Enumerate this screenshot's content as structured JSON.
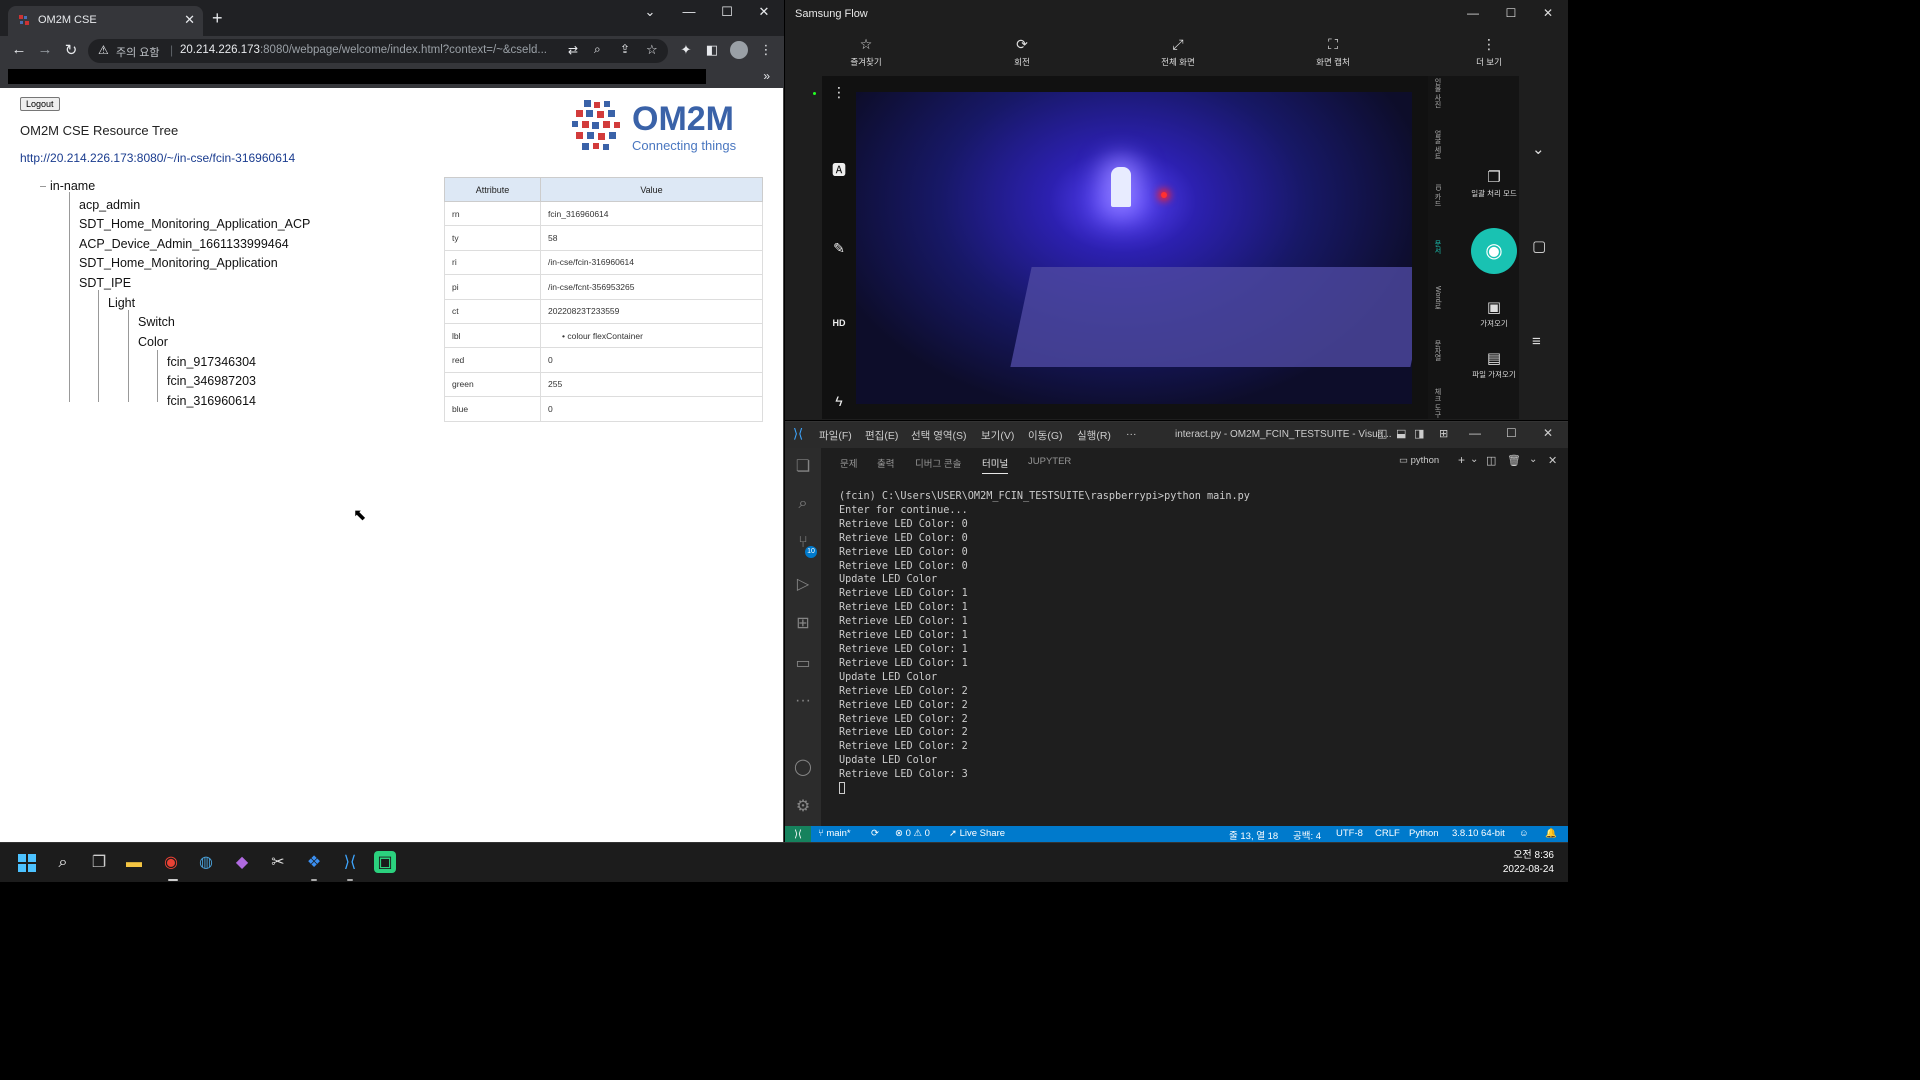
{
  "chrome": {
    "tab_title": "OM2M CSE",
    "new_tab": "+",
    "security_label": "주의 요함",
    "url_host": "20.214.226.173",
    "url_path": ":8080/webpage/welcome/index.html?context=/~&cseld...",
    "more_bookmarks": "»"
  },
  "om2m": {
    "logout_label": "Logout",
    "title": "OM2M CSE Resource Tree",
    "resource_url": "http://20.214.226.173:8080/~/in-cse/fcin-316960614",
    "logo_text": "OM2M",
    "logo_subtext": "Connecting things",
    "tree": {
      "root": "in-name",
      "n1": "acp_admin",
      "n2": "SDT_Home_Monitoring_Application_ACP",
      "n3": "ACP_Device_Admin_1661133999464",
      "n4": "SDT_Home_Monitoring_Application",
      "n5": "SDT_IPE",
      "n6": "Light",
      "n7": "Switch",
      "n8": "Color",
      "n9": "fcin_917346304",
      "n10": "fcin_346987203",
      "n11": "fcin_316960614"
    },
    "table": {
      "header_attr": "Attribute",
      "header_value": "Value",
      "rows": [
        {
          "k": "rn",
          "v": "fcin_316960614"
        },
        {
          "k": "ty",
          "v": "58"
        },
        {
          "k": "ri",
          "v": "/in-cse/fcin-316960614"
        },
        {
          "k": "pi",
          "v": "/in-cse/fcnt-356953265"
        },
        {
          "k": "ct",
          "v": "20220823T233559"
        },
        {
          "k": "lbl",
          "v": "colour flexContainer"
        },
        {
          "k": "red",
          "v": "0"
        },
        {
          "k": "green",
          "v": "255"
        },
        {
          "k": "blue",
          "v": "0"
        }
      ]
    }
  },
  "flow": {
    "title": "Samsung Flow",
    "tools": [
      "즐겨찾기",
      "회전",
      "전체 화면",
      "화면 캡처",
      "더 보기"
    ],
    "side_labels": [
      "인물 사진",
      "얼굴 세트",
      "ID 카드",
      "문서",
      "Word로",
      "문자열",
      "체크 도구"
    ],
    "right_items": [
      "일괄 처리 모드",
      "가져오기",
      "파일 가져오기"
    ]
  },
  "vscode": {
    "menus": [
      "파일(F)",
      "편집(E)",
      "선택 영역(S)",
      "보기(V)",
      "이동(G)",
      "실행(R)",
      "···"
    ],
    "window_title": "interact.py - OM2M_FCIN_TESTSUITE - Visua...",
    "panel_tabs": [
      "문제",
      "출력",
      "디버그 콘솔",
      "터미널",
      "JUPYTER"
    ],
    "terminal_kind": "python",
    "terminal_lines": [
      "(fcin) C:\\Users\\USER\\OM2M_FCIN_TESTSUITE\\raspberrypi>python main.py",
      "Enter for continue...",
      "Retrieve LED Color: 0",
      "Retrieve LED Color: 0",
      "Retrieve LED Color: 0",
      "Retrieve LED Color: 0",
      "Update LED Color",
      "Retrieve LED Color: 1",
      "Retrieve LED Color: 1",
      "Retrieve LED Color: 1",
      "Retrieve LED Color: 1",
      "Retrieve LED Color: 1",
      "Retrieve LED Color: 1",
      "Update LED Color",
      "Retrieve LED Color: 2",
      "Retrieve LED Color: 2",
      "Retrieve LED Color: 2",
      "Retrieve LED Color: 2",
      "Retrieve LED Color: 2",
      "Update LED Color",
      "Retrieve LED Color: 3"
    ],
    "scm_badge": "10",
    "status": {
      "branch": "main*",
      "problems": "⊗ 0 ⚠ 0",
      "live_share": "Live Share",
      "cursor_pos": "줄 13, 열 18",
      "spaces": "공백: 4",
      "encoding": "UTF-8",
      "eol": "CRLF",
      "language": "Python",
      "interpreter": "3.8.10 64-bit"
    }
  },
  "taskbar": {
    "time": "오전 8:36",
    "date": "2022-08-24"
  },
  "colors": {
    "vs_status_blue": "#007acc",
    "flow_capture_teal": "#19c2b2",
    "chrome_dark": "#202124"
  }
}
